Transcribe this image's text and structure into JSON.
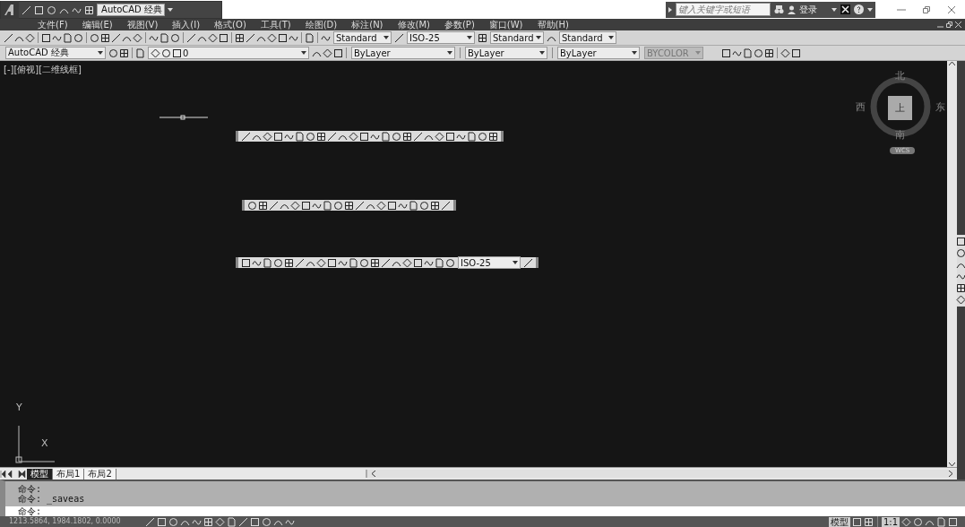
{
  "title_bar": {
    "workspace": "AutoCAD 经典",
    "search": {
      "placeholder": "键入关键字或短语"
    },
    "sign_in": "登录"
  },
  "menu": [
    "文件(F)",
    "编辑(E)",
    "视图(V)",
    "插入(I)",
    "格式(O)",
    "工具(T)",
    "绘图(D)",
    "标注(N)",
    "修改(M)",
    "参数(P)",
    "窗口(W)",
    "帮助(H)"
  ],
  "toolbar_1": {
    "text_style": "Standard",
    "dim_style": "ISO-25",
    "table_style": "Standard",
    "multileader_style": "Standard"
  },
  "toolbar_2": {
    "workspace": "AutoCAD 经典",
    "layer": "0",
    "layer_color": "ByLayer",
    "linetype": "ByLayer",
    "lineweight": "ByLayer",
    "plot_style": {
      "label": "BYCOLOR",
      "disabled": true
    }
  },
  "viewport_label": "[-][俯视][二维线框]",
  "viewcube": {
    "north": "北",
    "west": "西",
    "east": "东",
    "south": "南",
    "face": "上",
    "ucs": "WCS"
  },
  "ucs_icon": {
    "y": "Y",
    "x": "X"
  },
  "dimension_toolbar": {
    "dim_style": "ISO-25"
  },
  "layout_tabs": [
    {
      "label": "模型",
      "selected": true
    },
    {
      "label": "布局1",
      "selected": false
    },
    {
      "label": "布局2",
      "selected": false
    }
  ],
  "command_history": [
    "命令:",
    "命令: _saveas"
  ],
  "command_input": {
    "prompt": "命令:"
  },
  "status_bar": {
    "coordinates": "1213.5864, 1984.1802, 0.0000",
    "model": "模型",
    "scale": "1:1"
  }
}
